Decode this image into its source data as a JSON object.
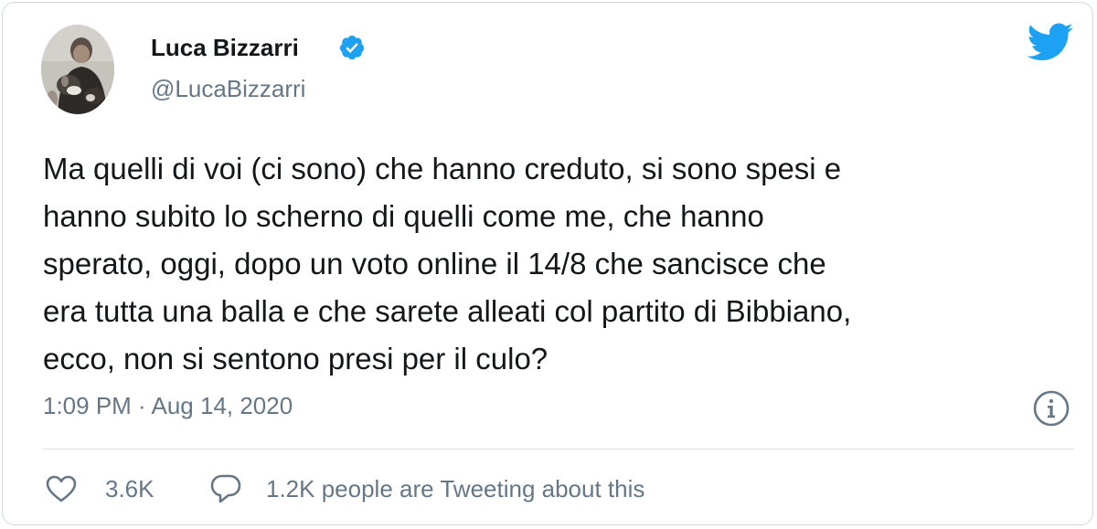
{
  "author": {
    "name": "Luca Bizzarri",
    "handle": "@LucaBizzarri",
    "verified": true
  },
  "tweet": {
    "lines": [
      "Ma quelli di voi (ci sono) che hanno creduto, si sono spesi e",
      "hanno subito lo scherno di quelli come me, che hanno",
      "sperato, oggi, dopo un voto online il 14/8 che sancisce che",
      "era tutta una balla e che sarete alleati col partito di Bibbiano,",
      "ecco, non si sentono presi per il culo?"
    ],
    "timestamp": "1:09 PM · Aug 14, 2020"
  },
  "actions": {
    "likes": "3.6K",
    "conversation": "1.2K people are Tweeting about this"
  },
  "icons": {
    "logo": "twitter-bird-icon",
    "verified": "verified-badge-icon",
    "info": "info-icon",
    "like": "heart-icon",
    "reply": "speech-bubble-icon"
  },
  "colors": {
    "twitter_blue": "#1da1f2",
    "text_primary": "#14171a",
    "text_secondary": "#657786",
    "border": "#cfd9de"
  }
}
